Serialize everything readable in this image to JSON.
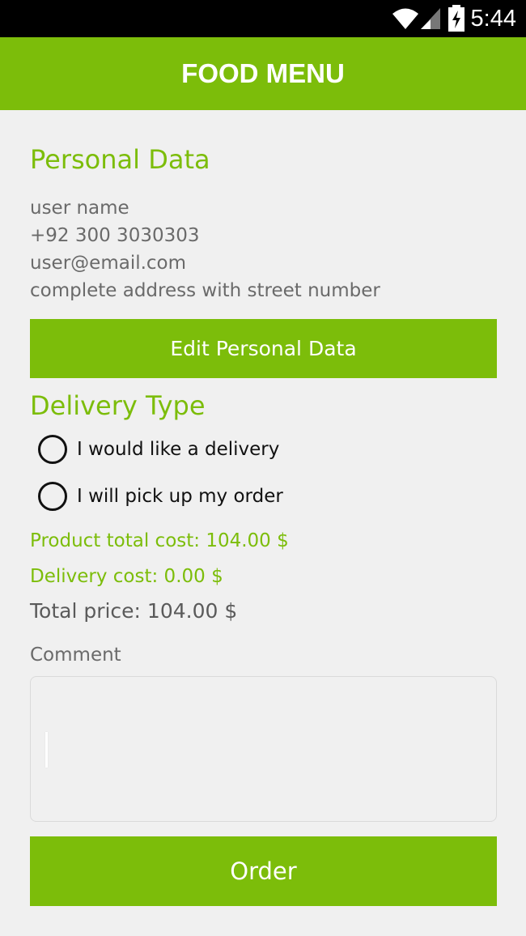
{
  "status_bar": {
    "time": "5:44",
    "icons": [
      "wifi-icon",
      "signal-icon",
      "battery-charging-icon"
    ]
  },
  "app_bar": {
    "title": "FOOD MENU"
  },
  "personal": {
    "title": "Personal Data",
    "name": "user name",
    "phone": "+92 300 3030303",
    "email": "user@email.com",
    "address": "complete address with street number",
    "edit_label": "Edit Personal Data"
  },
  "delivery": {
    "title": "Delivery Type",
    "options": [
      {
        "label": "I would like a delivery",
        "selected": false
      },
      {
        "label": "I will pick up my order",
        "selected": false
      }
    ]
  },
  "costs": {
    "product_total": "Product total cost: 104.00 $",
    "delivery": "Delivery cost: 0.00 $",
    "total": "Total price: 104.00 $"
  },
  "comment": {
    "label": "Comment",
    "value": ""
  },
  "order_label": "Order",
  "colors": {
    "accent": "#7cbd0a",
    "background": "#f0f0f0",
    "secondary_text": "#6a6a6a"
  }
}
